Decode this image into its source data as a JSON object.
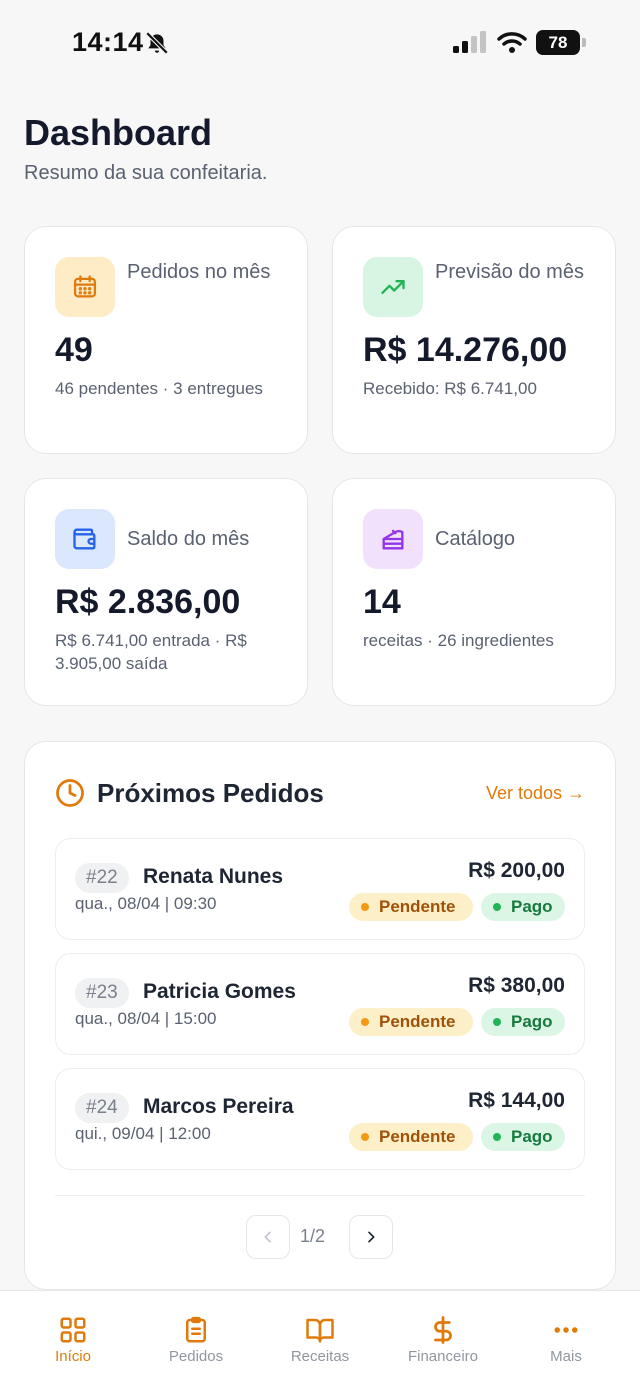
{
  "status_bar": {
    "time": "14:14",
    "battery": "78"
  },
  "header": {
    "title": "Dashboard",
    "subtitle": "Resumo da sua confeitaria."
  },
  "stats": [
    {
      "label": "Pedidos no mês",
      "value": "49",
      "sub": "46 pendentes · 3 entregues",
      "icon": "calendar-icon",
      "color": "#e07a0a"
    },
    {
      "label": "Previsão do mês",
      "value": "R$ 14.276,00",
      "sub": "Recebido: R$ 6.741,00",
      "icon": "trending-up-icon",
      "color": "#22b457"
    },
    {
      "label": "Saldo do mês",
      "value": "R$ 2.836,00",
      "sub": "R$ 6.741,00 entrada · R$ 3.905,00 saída",
      "icon": "wallet-icon",
      "color": "#2563eb"
    },
    {
      "label": "Catálogo",
      "value": "14",
      "sub": "receitas · 26 ingredientes",
      "icon": "cake-icon",
      "color": "#9333ea"
    }
  ],
  "orders": {
    "title": "Próximos Pedidos",
    "view_all": "Ver todos →",
    "items": [
      {
        "id": "#22",
        "name": "Renata Nunes",
        "date": "qua., 08/04 | 09:30",
        "amount": "R$ 200,00",
        "status": "Pendente",
        "payment": "Pago"
      },
      {
        "id": "#23",
        "name": "Patricia Gomes",
        "date": "qua., 08/04 | 15:00",
        "amount": "R$ 380,00",
        "status": "Pendente",
        "payment": "Pago"
      },
      {
        "id": "#24",
        "name": "Marcos Pereira",
        "date": "qui., 09/04 | 12:00",
        "amount": "R$ 144,00",
        "status": "Pendente",
        "payment": "Pago"
      }
    ],
    "pagination": "1/2"
  },
  "nav": {
    "active": "Início",
    "items": [
      {
        "label": "Início",
        "icon": "grid-icon"
      },
      {
        "label": "Pedidos",
        "icon": "clipboard-icon"
      },
      {
        "label": "Receitas",
        "icon": "book-icon"
      },
      {
        "label": "Financeiro",
        "icon": "dollar-icon"
      },
      {
        "label": "Mais",
        "icon": "more-icon"
      }
    ]
  },
  "accent_color": "#e07a0a"
}
